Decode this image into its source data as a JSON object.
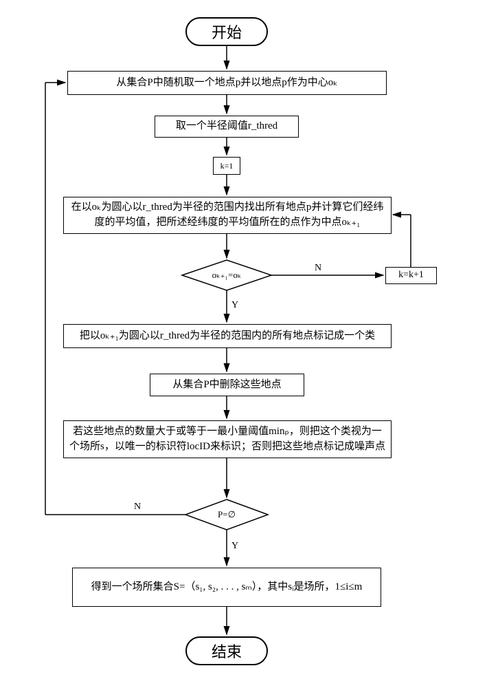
{
  "terminals": {
    "start": "开始",
    "end": "结束"
  },
  "steps": {
    "s1": "从集合P中随机取一个地点p并以地点p作为中心oₖ",
    "s2": "取一个半径阈值r_thred",
    "s3": "k=1",
    "s4": "在以oₖ为圆心以r_thred为半径的范围内找出所有地点p并计算它们经纬度的平均值，把所述经纬度的平均值所在的点作为中点oₖ₊₁",
    "s5": "k=k+1",
    "s6": "把以oₖ₊₁为圆心以r_thred为半径的范围内的所有地点标记成一个类",
    "s7": "从集合P中删除这些地点",
    "s8": "若这些地点的数量大于或等于一最小量阈值minₚ，则把这个类视为一个场所s，以唯一的标识符locID来标识；否则把这些地点标记成噪声点",
    "s9": "得到一个场所集合S=（s₁, s₂, . . . , sₘ），其中sᵢ是场所，1≤i≤m"
  },
  "decisions": {
    "d1": "oₖ₊₁=oₖ",
    "d2": "P=∅"
  },
  "labels": {
    "yes": "Y",
    "no": "N"
  }
}
